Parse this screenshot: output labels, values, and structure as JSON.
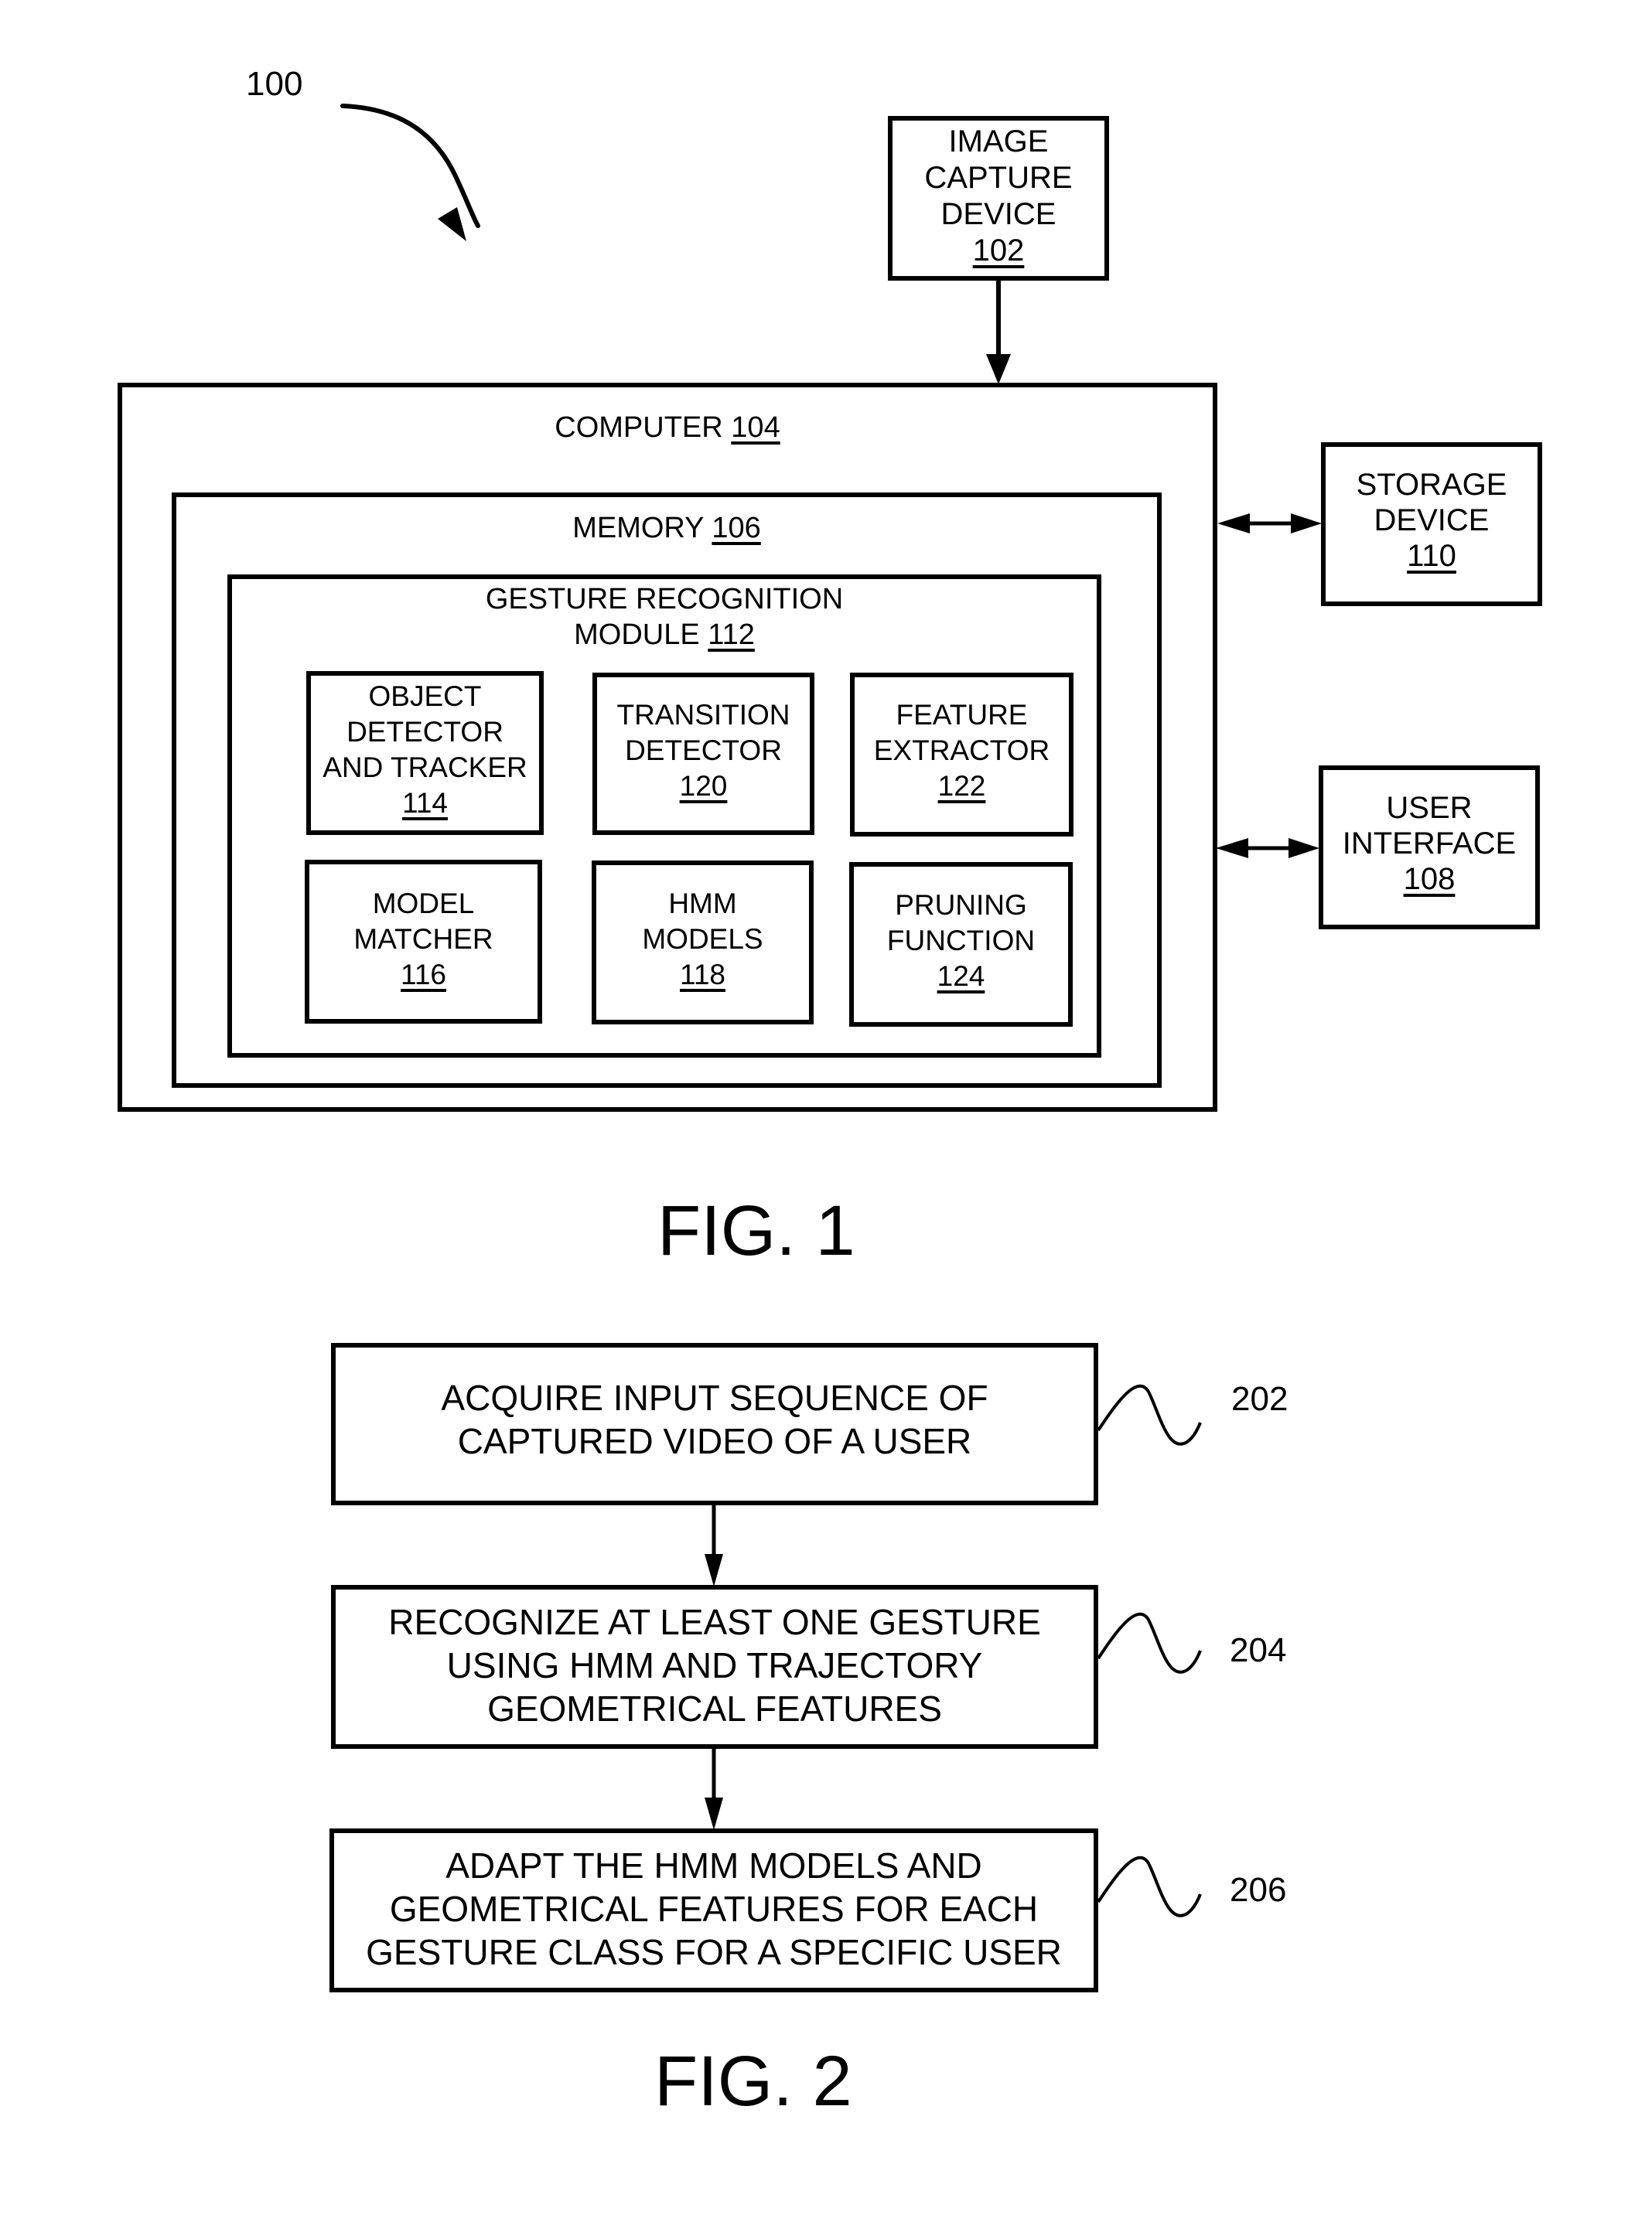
{
  "fig1": {
    "ref_label": "100",
    "caption": "FIG. 1",
    "image_capture": {
      "lines": [
        "IMAGE",
        "CAPTURE",
        "DEVICE"
      ],
      "ref": "102"
    },
    "computer": {
      "label": "COMPUTER",
      "ref": "104"
    },
    "memory": {
      "label": "MEMORY",
      "ref": "106"
    },
    "module": {
      "lines": [
        "GESTURE RECOGNITION",
        "MODULE"
      ],
      "ref": "112"
    },
    "components": [
      {
        "lines": [
          "OBJECT",
          "DETECTOR",
          "AND TRACKER"
        ],
        "ref": "114"
      },
      {
        "lines": [
          "TRANSITION",
          "DETECTOR"
        ],
        "ref": "120"
      },
      {
        "lines": [
          "FEATURE",
          "EXTRACTOR"
        ],
        "ref": "122"
      },
      {
        "lines": [
          "MODEL",
          "MATCHER"
        ],
        "ref": "116"
      },
      {
        "lines": [
          "HMM",
          "MODELS"
        ],
        "ref": "118"
      },
      {
        "lines": [
          "PRUNING",
          "FUNCTION"
        ],
        "ref": "124"
      }
    ],
    "storage": {
      "lines": [
        "STORAGE",
        "DEVICE"
      ],
      "ref": "110"
    },
    "user_interface": {
      "lines": [
        "USER",
        "INTERFACE"
      ],
      "ref": "108"
    }
  },
  "fig2": {
    "caption": "FIG. 2",
    "steps": [
      {
        "lines": [
          "ACQUIRE INPUT SEQUENCE OF",
          "CAPTURED VIDEO OF A USER"
        ],
        "ref": "202"
      },
      {
        "lines": [
          "RECOGNIZE AT LEAST ONE GESTURE",
          "USING HMM AND TRAJECTORY",
          "GEOMETRICAL FEATURES"
        ],
        "ref": "204"
      },
      {
        "lines": [
          "ADAPT THE HMM MODELS AND",
          "GEOMETRICAL FEATURES FOR EACH",
          "GESTURE CLASS FOR A SPECIFIC USER"
        ],
        "ref": "206"
      }
    ]
  }
}
